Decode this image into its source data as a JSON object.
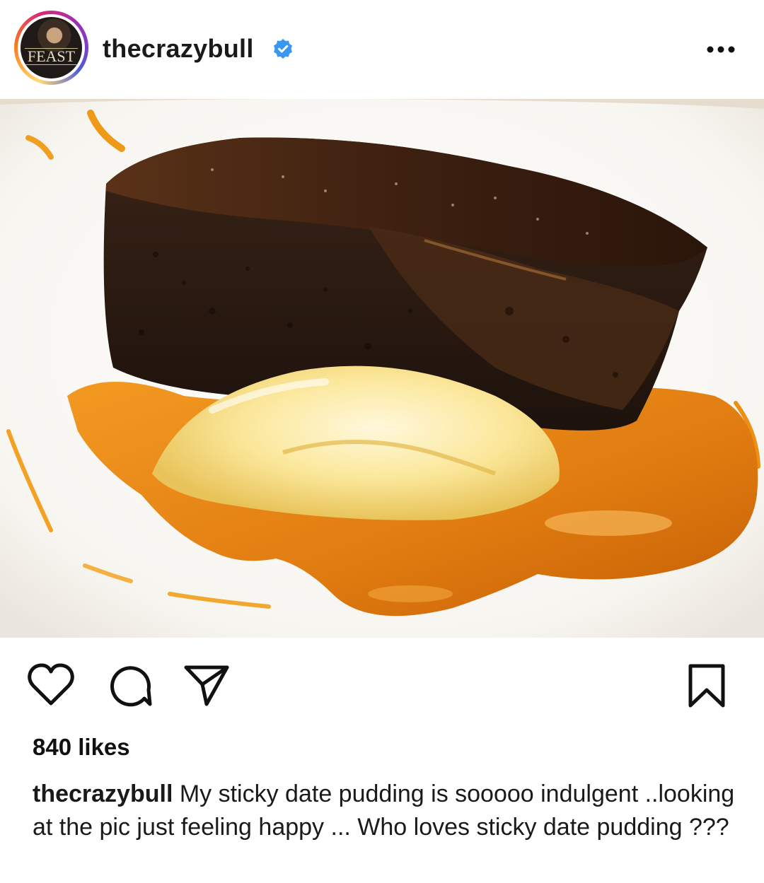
{
  "header": {
    "username": "thecrazybull",
    "avatar_text": "FEAST",
    "verified": true,
    "verified_color": "#3897f0"
  },
  "post": {
    "image_alt": "sticky date pudding with caramel sauce and cream",
    "likes_text": "840 likes",
    "caption_user": "thecrazybull",
    "caption_text": "My sticky date pudding is sooooo indulgent ..looking at the pic just feeling happy ... Who loves sticky date pudding ???"
  },
  "icons": {
    "more": "more-options-icon",
    "like": "heart-icon",
    "comment": "comment-icon",
    "share": "share-icon",
    "save": "bookmark-icon"
  },
  "colors": {
    "text": "#1a1a1a",
    "caramel": "#e07b10",
    "pudding": "#2a1a12"
  }
}
